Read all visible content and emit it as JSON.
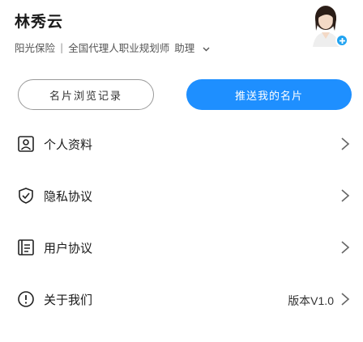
{
  "profile": {
    "name": "林秀云",
    "department": "阳光保险",
    "separator": "|",
    "position": "全国代理人职业规划师",
    "role_select": "助理",
    "avatar_icon": "avatar-portrait"
  },
  "actions": {
    "record_label": "名片浏览记录",
    "push_label": "推送我的名片"
  },
  "menu": [
    {
      "icon": "personal-info-icon",
      "label": "个人资料",
      "value": ""
    },
    {
      "icon": "privacy-policy-icon",
      "label": "隐私协议",
      "value": ""
    },
    {
      "icon": "user-agreement-icon",
      "label": "用户协议",
      "value": ""
    },
    {
      "icon": "about-icon",
      "label": "关于我们",
      "value": "版本V1.0"
    }
  ],
  "colors": {
    "accent": "#1e8fff",
    "badge": "#21a3f1"
  }
}
